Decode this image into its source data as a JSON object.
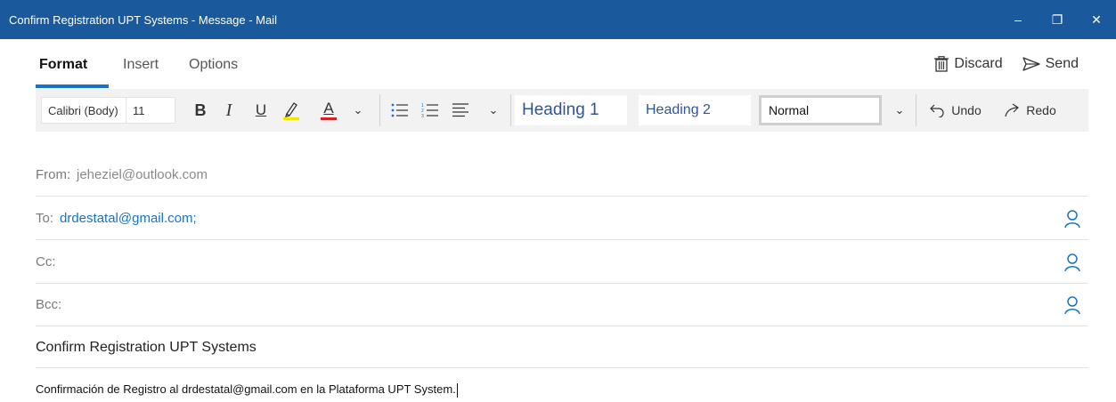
{
  "window": {
    "title": "Confirm Registration UPT Systems - Message - Mail",
    "minimize_glyph": "–",
    "restore_glyph": "❐",
    "close_glyph": "✕"
  },
  "tabs": [
    {
      "label": "Format",
      "active": true
    },
    {
      "label": "Insert",
      "active": false
    },
    {
      "label": "Options",
      "active": false
    }
  ],
  "actions": {
    "discard_label": "Discard",
    "send_label": "Send"
  },
  "toolbar": {
    "font_name": "Calibri (Body)",
    "font_size": "11",
    "bold": "B",
    "italic": "I",
    "underline": "U",
    "font_color": "A",
    "chevron": "⌄",
    "styles": {
      "heading1": "Heading 1",
      "heading2": "Heading 2",
      "normal": "Normal"
    },
    "undo_label": "Undo",
    "redo_label": "Redo"
  },
  "fields": {
    "from_label": "From:",
    "from_value": "jeheziel@outlook.com",
    "to_label": "To:",
    "to_value": "drdestatal@gmail.com;",
    "cc_label": "Cc:",
    "bcc_label": "Bcc:"
  },
  "subject": "Confirm Registration UPT Systems",
  "body_text": "Confirmación de Registro al drdestatal@gmail.com en la Plataforma UPT System.",
  "colors": {
    "titlebar": "#1a5a9c",
    "accent": "#1673c9",
    "highlighter": "#f2e600",
    "font_color_bar": "#d42020"
  },
  "icons": [
    "discard-icon",
    "send-icon",
    "bullets-icon",
    "numbering-icon",
    "align-icon",
    "undo-icon",
    "redo-icon",
    "person-icon"
  ]
}
